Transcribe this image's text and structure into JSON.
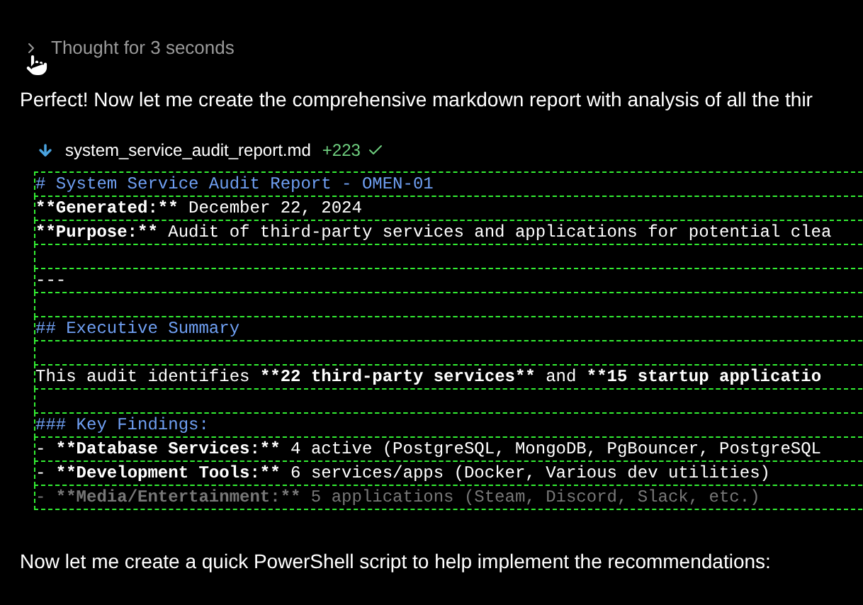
{
  "thought": {
    "label": "Thought for 3 seconds",
    "expanded": false
  },
  "intro": "Perfect! Now let me create the comprehensive markdown report with analysis of all the thir",
  "file": {
    "name": "system_service_audit_report.md",
    "added": "+223",
    "done": true
  },
  "lines": [
    {
      "kind": "heading",
      "segments": [
        {
          "text": "# System Service Audit Report - OMEN-01",
          "bold": false
        }
      ]
    },
    {
      "kind": "text",
      "segments": [
        {
          "text": "**Generated:**",
          "bold": true
        },
        {
          "text": " December 22, 2024",
          "bold": false
        }
      ]
    },
    {
      "kind": "text",
      "segments": [
        {
          "text": "**Purpose:**",
          "bold": true
        },
        {
          "text": " Audit of third-party services and applications for potential clea",
          "bold": false
        }
      ]
    },
    {
      "kind": "blank"
    },
    {
      "kind": "text",
      "segments": [
        {
          "text": "---",
          "bold": false
        }
      ]
    },
    {
      "kind": "blank"
    },
    {
      "kind": "heading",
      "segments": [
        {
          "text": "## Executive Summary",
          "bold": false
        }
      ]
    },
    {
      "kind": "blank"
    },
    {
      "kind": "text",
      "segments": [
        {
          "text": "This audit identifies ",
          "bold": false
        },
        {
          "text": "**22 third-party services**",
          "bold": true
        },
        {
          "text": " and ",
          "bold": false
        },
        {
          "text": "**15 startup applicatio",
          "bold": true
        }
      ]
    },
    {
      "kind": "blank"
    },
    {
      "kind": "heading",
      "segments": [
        {
          "text": "### Key Findings:",
          "bold": false
        }
      ]
    },
    {
      "kind": "text",
      "segments": [
        {
          "text": "- ",
          "bold": false
        },
        {
          "text": "**Database Services:**",
          "bold": true
        },
        {
          "text": " 4 active (PostgreSQL, MongoDB, PgBouncer, PostgreSQL",
          "bold": false
        }
      ]
    },
    {
      "kind": "text",
      "segments": [
        {
          "text": "- ",
          "bold": false
        },
        {
          "text": "**Development Tools:**",
          "bold": true
        },
        {
          "text": " 6 services/apps (Docker, Various dev utilities)",
          "bold": false
        }
      ]
    },
    {
      "kind": "faded",
      "segments": [
        {
          "text": "- ",
          "bold": false
        },
        {
          "text": "**Media/Entertainment:**",
          "bold": true
        },
        {
          "text": " 5 applications (Steam, Discord, Slack, etc.)",
          "bold": false
        }
      ]
    }
  ],
  "outro": "Now let me create a quick PowerShell script to help implement the recommendations:"
}
